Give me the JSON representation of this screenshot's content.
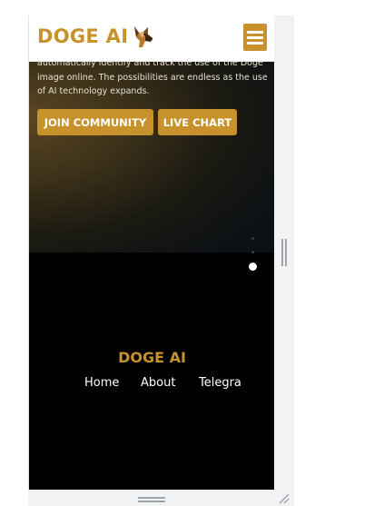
{
  "header": {
    "brand": "DOGE AI",
    "logo_icon": "dog-head-icon",
    "menu_icon": "hamburger-menu-icon"
  },
  "hero": {
    "description": "automatically identify and track the use of the Doge image online. The possibilities are endless as the use of AI technology expands.",
    "buttons": {
      "join": "JOIN COMMUNITY",
      "live": "LIVE CHART"
    }
  },
  "carousel": {
    "active_index": 3,
    "count": 3
  },
  "footer": {
    "brand": "DOGE AI",
    "nav": [
      "Home",
      "About",
      "Telegram"
    ]
  },
  "colors": {
    "accent": "#c7912c",
    "footer_bg": "#000000",
    "header_bg": "#ffffff"
  }
}
